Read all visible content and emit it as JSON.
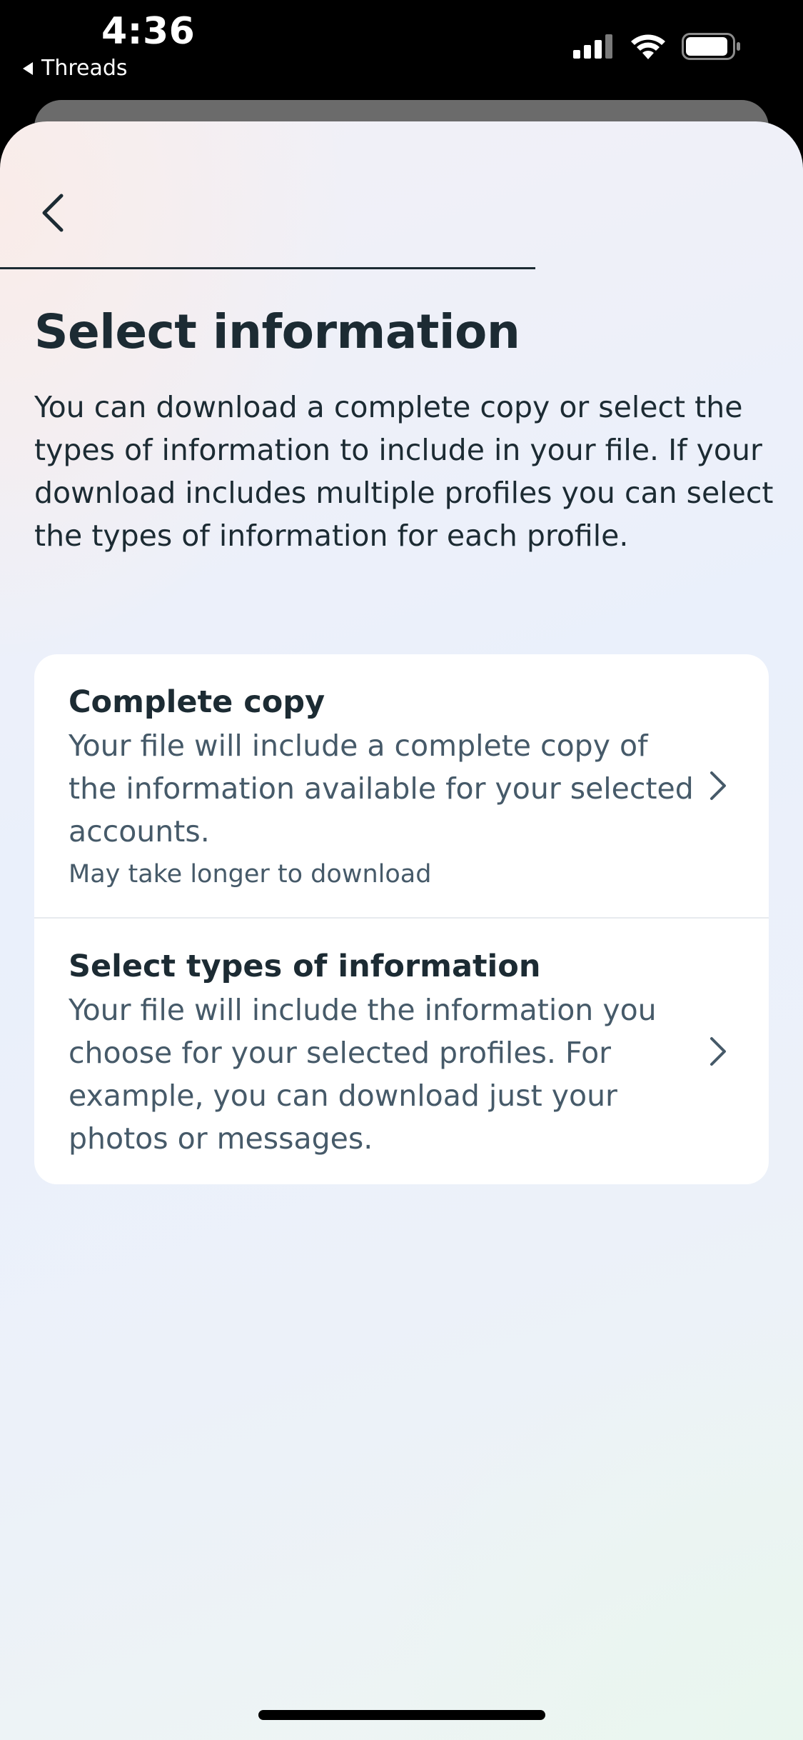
{
  "status_bar": {
    "time": "4:36",
    "back_app_label": "Threads"
  },
  "header": {
    "progress_fraction": 0.667
  },
  "main": {
    "title": "Select information",
    "description": "You can download a complete copy or select the types of information to include in your file. If your download includes multiple profiles you can select the types of information for each profile."
  },
  "options": [
    {
      "title": "Complete copy",
      "description": "Your file will include a complete copy of the information available for your selected accounts.",
      "note": "May take longer to download"
    },
    {
      "title": "Select types of information",
      "description": "Your file will include the information you choose for your selected profiles. For example, you can download just your photos or messages."
    }
  ],
  "icons": {
    "back": "chevron-left-icon",
    "option_arrow": "chevron-right-icon",
    "signal": "cellular-signal-icon",
    "wifi": "wifi-icon",
    "battery": "battery-icon"
  },
  "colors": {
    "text_primary": "#1c2b33",
    "text_secondary": "#465a69",
    "card_bg": "#ffffff",
    "status_bar_bg": "#000000"
  }
}
